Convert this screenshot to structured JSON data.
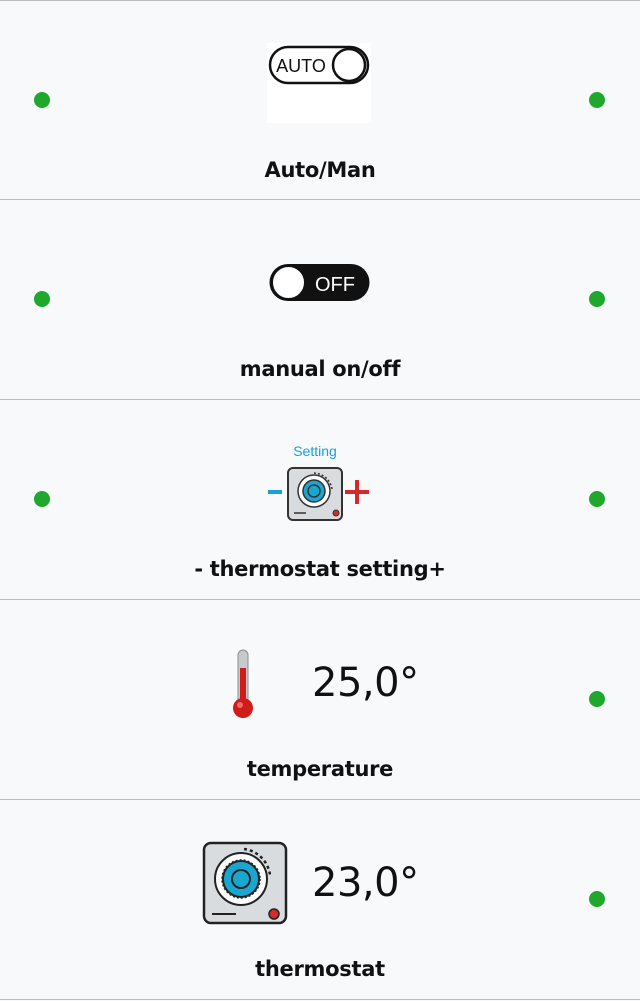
{
  "colors": {
    "status_green": "#1fa82c",
    "divider": "#b9bcc0",
    "background": "#f8f9fb",
    "dial_blue": "#1aa7cf",
    "minus_blue": "#1a9fd6",
    "plus_red": "#d42a2a",
    "thermo_red": "#d01b1b"
  },
  "rows": [
    {
      "name": "auto-man",
      "label": "Auto/Man",
      "icon": "auto-toggle-icon",
      "icon_text": "AUTO",
      "status_left": "green",
      "status_right": "green"
    },
    {
      "name": "manual-on-off",
      "label": "manual on/off",
      "icon": "off-toggle-icon",
      "icon_text": "OFF",
      "status_left": "green",
      "status_right": "green"
    },
    {
      "name": "thermostat-setting",
      "label": "- thermostat setting+",
      "icon": "thermostat-dial-icon",
      "icon_caption": "Setting",
      "minus": "−",
      "plus": "+",
      "status_left": "green",
      "status_right": "green"
    },
    {
      "name": "temperature",
      "label": "temperature",
      "icon": "thermometer-icon",
      "value": "25,0°",
      "status_right": "green"
    },
    {
      "name": "thermostat",
      "label": "thermostat",
      "icon": "thermostat-dial-icon",
      "value": "23,0°",
      "status_right": "green"
    }
  ]
}
